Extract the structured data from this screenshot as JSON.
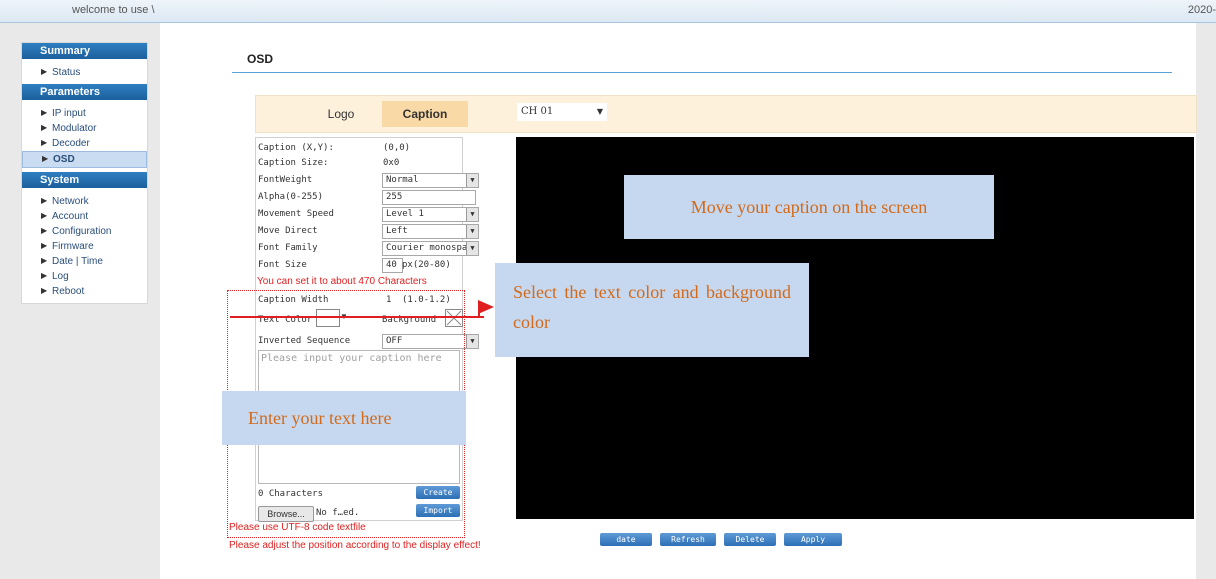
{
  "header": {
    "welcome": "welcome to use \\",
    "date": "2020-"
  },
  "nav": {
    "sections": [
      {
        "title": "Summary",
        "items": [
          {
            "label": "Status"
          }
        ]
      },
      {
        "title": "Parameters",
        "items": [
          {
            "label": "IP input"
          },
          {
            "label": "Modulator"
          },
          {
            "label": "Decoder"
          },
          {
            "label": "OSD"
          }
        ]
      },
      {
        "title": "System",
        "items": [
          {
            "label": "Network"
          },
          {
            "label": "Account"
          },
          {
            "label": "Configuration"
          },
          {
            "label": "Firmware"
          },
          {
            "label": "Date | Time"
          },
          {
            "label": "Log"
          },
          {
            "label": "Reboot"
          }
        ]
      }
    ]
  },
  "page": {
    "title": "OSD"
  },
  "tabs": {
    "logo": "Logo",
    "caption": "Caption"
  },
  "channel": {
    "selected": "CH 01"
  },
  "form": {
    "caption_xy_label": "Caption (X,Y):",
    "caption_xy_value": "(0,0)",
    "caption_size_label": "Caption Size:",
    "caption_size_value": "0x0",
    "font_weight_label": "FontWeight",
    "font_weight_value": "Normal",
    "alpha_label": "Alpha(0-255)",
    "alpha_value": "255",
    "movement_speed_label": "Movement Speed",
    "movement_speed_value": "Level 1",
    "move_direct_label": "Move Direct",
    "move_direct_value": "Left",
    "font_family_label": "Font Family",
    "font_family_value": "Courier monospac",
    "font_size_label": "Font Size",
    "font_size_value": "40",
    "font_size_hint": "px(20-80)",
    "chars_note": "You can set it to about 470 Characters",
    "caption_width_label": "Caption Width",
    "caption_width_value": "1",
    "caption_width_hint": "(1.0-1.2)",
    "text_color_label": "Text Color",
    "background_label": "Background",
    "inverted_label": "Inverted Sequence",
    "inverted_value": "OFF",
    "caption_placeholder": "Please input your caption here",
    "char_count": "0 Characters",
    "create_button": "Create",
    "browse_button": "Browse...",
    "file_name": "No f…ed.",
    "import_button": "Import",
    "utf8_note": "Please use UTF-8 code textfile",
    "adjust_note": "Please adjust the position according to the display effect!"
  },
  "bottom_buttons": {
    "date": "date",
    "refresh": "Refresh",
    "delete": "Delete",
    "apply": "Apply"
  },
  "annotations": {
    "move": "Move your caption on the screen",
    "select": "Select the text color and background color",
    "enter": "Enter your text here"
  },
  "colors": {
    "nav_header": "#1c5f9d",
    "caption_tab": "#f9d9a5",
    "annotation_bg": "#c5d8ef",
    "annotation_text": "#d36a1a",
    "warning": "#e02020"
  }
}
